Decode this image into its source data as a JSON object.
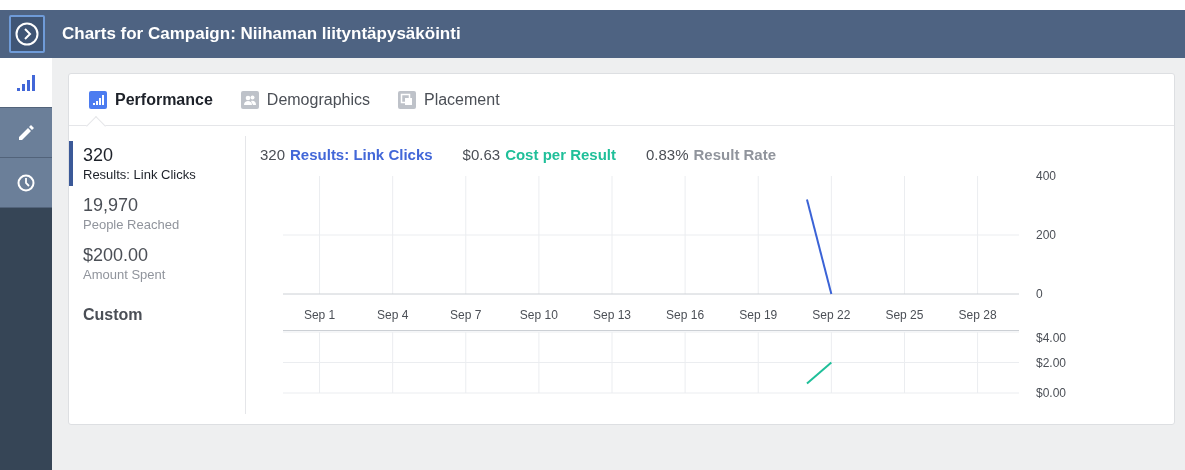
{
  "header": {
    "title": "Charts for Campaign: Niihaman liityntäpysäköinti"
  },
  "sidebar": {
    "items": [
      {
        "kind": "chart",
        "selected": true
      },
      {
        "kind": "edit",
        "selected": false
      },
      {
        "kind": "history",
        "selected": false
      }
    ]
  },
  "tabs": [
    {
      "label": "Performance",
      "kind": "chart",
      "selected": true
    },
    {
      "label": "Demographics",
      "kind": "people",
      "selected": false
    },
    {
      "label": "Placement",
      "kind": "placement",
      "selected": false
    }
  ],
  "metrics": [
    {
      "value": "320",
      "label": "Results: Link Clicks",
      "selected": true
    },
    {
      "value": "19,970",
      "label": "People Reached",
      "selected": false
    },
    {
      "value": "$200.00",
      "label": "Amount Spent",
      "selected": false
    }
  ],
  "custom_label": "Custom",
  "summary": [
    {
      "value": "320",
      "label": "Results: Link Clicks",
      "color": "#4267d8"
    },
    {
      "value": "$0.63",
      "label": "Cost per Result",
      "color": "#1fbf99"
    },
    {
      "value": "0.83%",
      "label": "Result Rate",
      "color": "#90949c"
    }
  ],
  "charts": [
    {
      "chart_data": {
        "type": "line",
        "categories": [
          "Sep 1",
          null,
          null,
          "Sep 4",
          null,
          null,
          "Sep 7",
          null,
          null,
          "Sep 10",
          null,
          null,
          "Sep 13",
          null,
          null,
          "Sep 16",
          null,
          null,
          "Sep 19",
          null,
          null,
          "Sep 22",
          null,
          null,
          "Sep 25",
          null,
          null,
          "Sep 28",
          null
        ],
        "series": [
          {
            "color": "#3b63d6",
            "values": [
              null,
              null,
              null,
              null,
              null,
              null,
              null,
              null,
              null,
              null,
              null,
              null,
              null,
              null,
              null,
              null,
              null,
              null,
              null,
              null,
              320,
              0,
              null,
              null,
              null,
              null,
              null,
              null,
              null
            ]
          }
        ],
        "ylim": [
          0,
          400
        ],
        "yticks": [
          0,
          200,
          400
        ],
        "grid": true
      }
    },
    {
      "chart_data": {
        "type": "line",
        "categories": [
          null,
          null,
          null,
          null,
          null,
          null,
          null,
          null,
          null,
          null,
          null,
          null,
          null,
          null,
          null,
          null,
          null,
          null,
          null,
          null,
          null,
          null,
          null,
          null,
          null,
          null,
          null,
          null,
          null
        ],
        "series": [
          {
            "color": "#1fbf99",
            "values": [
              null,
              null,
              null,
              null,
              null,
              null,
              null,
              null,
              null,
              null,
              null,
              null,
              null,
              null,
              null,
              null,
              null,
              null,
              null,
              null,
              0.63,
              2,
              null,
              null,
              null,
              null,
              null,
              null,
              null
            ]
          }
        ],
        "ylim": [
          0,
          4
        ],
        "grid": true,
        "yticks": [
          {
            "value": 0,
            "label": "$0.00"
          },
          {
            "value": 2,
            "label": "$2.00"
          },
          {
            "value": 4,
            "label": "$4.00"
          }
        ]
      }
    }
  ]
}
